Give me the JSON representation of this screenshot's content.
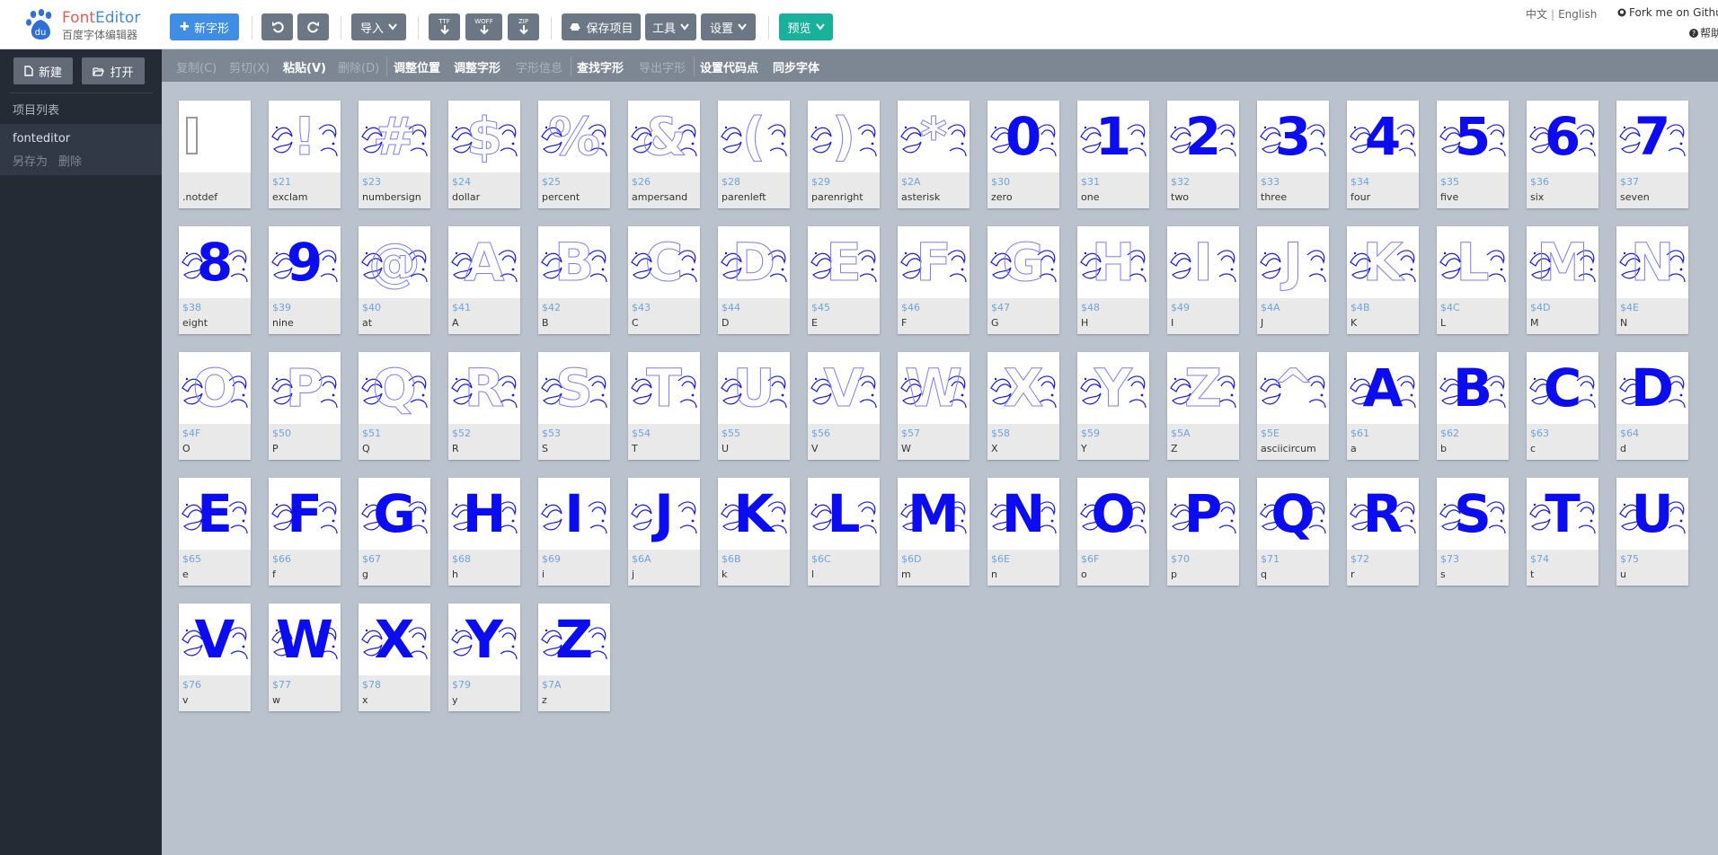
{
  "app": {
    "title_part1": "Font",
    "title_part2": "Editor",
    "subtitle": "百度字体编辑器",
    "logo_text": "du"
  },
  "toolbar": {
    "new_glyph": "新字形",
    "import": "导入",
    "export_ttf": "TTF",
    "export_woff": "WOFF",
    "export_zip": "ZIP",
    "save_project": "保存项目",
    "tools": "工具",
    "settings": "设置",
    "preview": "预览"
  },
  "lang": {
    "zh": "中文",
    "en": "English"
  },
  "links": {
    "fork": "Fork me on Github",
    "help": "帮助"
  },
  "sidebar": {
    "new_label": "新建",
    "open_label": "打开",
    "heading": "项目列表",
    "project": {
      "name": "fonteditor",
      "save_as": "另存为",
      "delete": "删除"
    }
  },
  "editbar": {
    "copy": "复制(C)",
    "cut": "剪切(X)",
    "paste": "粘贴(V)",
    "delete": "删除(D)",
    "adjust_pos": "调整位置",
    "adjust_glyph": "调整字形",
    "glyph_info": "字形信息",
    "find_glyph": "查找字形",
    "export_glyph": "导出字形",
    "set_codepoint": "设置代码点",
    "sync_font": "同步字体"
  },
  "colors": {
    "accent": "#3d8ee4",
    "teal": "#18b19c",
    "glyph_blue": "#0c0cf0",
    "sidebar_bg": "#252b35",
    "canvas_bg": "#b9c2cd"
  },
  "glyphs": [
    {
      "char": "",
      "code": "",
      "name": ".notdef",
      "style": "notdef"
    },
    {
      "char": "!",
      "code": "$21",
      "name": "exclam",
      "style": "outline"
    },
    {
      "char": "#",
      "code": "$23",
      "name": "numbersign",
      "style": "outline"
    },
    {
      "char": "$",
      "code": "$24",
      "name": "dollar",
      "style": "outline"
    },
    {
      "char": "%",
      "code": "$25",
      "name": "percent",
      "style": "outline"
    },
    {
      "char": "&",
      "code": "$26",
      "name": "ampersand",
      "style": "outline"
    },
    {
      "char": "(",
      "code": "$28",
      "name": "parenleft",
      "style": "outline"
    },
    {
      "char": ")",
      "code": "$29",
      "name": "parenright",
      "style": "outline"
    },
    {
      "char": "*",
      "code": "$2A",
      "name": "asterisk",
      "style": "outline"
    },
    {
      "char": "0",
      "code": "$30",
      "name": "zero",
      "style": "solid"
    },
    {
      "char": "1",
      "code": "$31",
      "name": "one",
      "style": "solid"
    },
    {
      "char": "2",
      "code": "$32",
      "name": "two",
      "style": "solid"
    },
    {
      "char": "3",
      "code": "$33",
      "name": "three",
      "style": "solid"
    },
    {
      "char": "4",
      "code": "$34",
      "name": "four",
      "style": "solid"
    },
    {
      "char": "5",
      "code": "$35",
      "name": "five",
      "style": "solid"
    },
    {
      "char": "6",
      "code": "$36",
      "name": "six",
      "style": "solid"
    },
    {
      "char": "7",
      "code": "$37",
      "name": "seven",
      "style": "solid"
    },
    {
      "char": "8",
      "code": "$38",
      "name": "eight",
      "style": "solid"
    },
    {
      "char": "9",
      "code": "$39",
      "name": "nine",
      "style": "solid"
    },
    {
      "char": "@",
      "code": "$40",
      "name": "at",
      "style": "outline"
    },
    {
      "char": "A",
      "code": "$41",
      "name": "A",
      "style": "outline"
    },
    {
      "char": "B",
      "code": "$42",
      "name": "B",
      "style": "outline"
    },
    {
      "char": "C",
      "code": "$43",
      "name": "C",
      "style": "outline"
    },
    {
      "char": "D",
      "code": "$44",
      "name": "D",
      "style": "outline"
    },
    {
      "char": "E",
      "code": "$45",
      "name": "E",
      "style": "outline"
    },
    {
      "char": "F",
      "code": "$46",
      "name": "F",
      "style": "outline"
    },
    {
      "char": "G",
      "code": "$47",
      "name": "G",
      "style": "outline"
    },
    {
      "char": "H",
      "code": "$48",
      "name": "H",
      "style": "outline"
    },
    {
      "char": "I",
      "code": "$49",
      "name": "I",
      "style": "outline"
    },
    {
      "char": "J",
      "code": "$4A",
      "name": "J",
      "style": "outline"
    },
    {
      "char": "K",
      "code": "$4B",
      "name": "K",
      "style": "outline"
    },
    {
      "char": "L",
      "code": "$4C",
      "name": "L",
      "style": "outline"
    },
    {
      "char": "M",
      "code": "$4D",
      "name": "M",
      "style": "outline"
    },
    {
      "char": "N",
      "code": "$4E",
      "name": "N",
      "style": "outline"
    },
    {
      "char": "O",
      "code": "$4F",
      "name": "O",
      "style": "outline"
    },
    {
      "char": "P",
      "code": "$50",
      "name": "P",
      "style": "outline"
    },
    {
      "char": "Q",
      "code": "$51",
      "name": "Q",
      "style": "outline"
    },
    {
      "char": "R",
      "code": "$52",
      "name": "R",
      "style": "outline"
    },
    {
      "char": "S",
      "code": "$53",
      "name": "S",
      "style": "outline"
    },
    {
      "char": "T",
      "code": "$54",
      "name": "T",
      "style": "outline"
    },
    {
      "char": "U",
      "code": "$55",
      "name": "U",
      "style": "outline"
    },
    {
      "char": "V",
      "code": "$56",
      "name": "V",
      "style": "outline"
    },
    {
      "char": "W",
      "code": "$57",
      "name": "W",
      "style": "outline"
    },
    {
      "char": "X",
      "code": "$58",
      "name": "X",
      "style": "outline"
    },
    {
      "char": "Y",
      "code": "$59",
      "name": "Y",
      "style": "outline"
    },
    {
      "char": "Z",
      "code": "$5A",
      "name": "Z",
      "style": "outline"
    },
    {
      "char": "^",
      "code": "$5E",
      "name": "asciicircum",
      "style": "outline"
    },
    {
      "char": "A",
      "code": "$61",
      "name": "a",
      "style": "solid"
    },
    {
      "char": "B",
      "code": "$62",
      "name": "b",
      "style": "solid"
    },
    {
      "char": "C",
      "code": "$63",
      "name": "c",
      "style": "solid"
    },
    {
      "char": "D",
      "code": "$64",
      "name": "d",
      "style": "solid"
    },
    {
      "char": "E",
      "code": "$65",
      "name": "e",
      "style": "solid"
    },
    {
      "char": "F",
      "code": "$66",
      "name": "f",
      "style": "solid"
    },
    {
      "char": "G",
      "code": "$67",
      "name": "g",
      "style": "solid"
    },
    {
      "char": "H",
      "code": "$68",
      "name": "h",
      "style": "solid"
    },
    {
      "char": "I",
      "code": "$69",
      "name": "i",
      "style": "solid"
    },
    {
      "char": "J",
      "code": "$6A",
      "name": "j",
      "style": "solid"
    },
    {
      "char": "K",
      "code": "$6B",
      "name": "k",
      "style": "solid"
    },
    {
      "char": "L",
      "code": "$6C",
      "name": "l",
      "style": "solid"
    },
    {
      "char": "M",
      "code": "$6D",
      "name": "m",
      "style": "solid"
    },
    {
      "char": "N",
      "code": "$6E",
      "name": "n",
      "style": "solid"
    },
    {
      "char": "O",
      "code": "$6F",
      "name": "o",
      "style": "solid"
    },
    {
      "char": "P",
      "code": "$70",
      "name": "p",
      "style": "solid"
    },
    {
      "char": "Q",
      "code": "$71",
      "name": "q",
      "style": "solid"
    },
    {
      "char": "R",
      "code": "$72",
      "name": "r",
      "style": "solid"
    },
    {
      "char": "S",
      "code": "$73",
      "name": "s",
      "style": "solid"
    },
    {
      "char": "T",
      "code": "$74",
      "name": "t",
      "style": "solid"
    },
    {
      "char": "U",
      "code": "$75",
      "name": "u",
      "style": "solid"
    },
    {
      "char": "V",
      "code": "$76",
      "name": "v",
      "style": "solid"
    },
    {
      "char": "W",
      "code": "$77",
      "name": "w",
      "style": "solid"
    },
    {
      "char": "X",
      "code": "$78",
      "name": "x",
      "style": "solid"
    },
    {
      "char": "Y",
      "code": "$79",
      "name": "y",
      "style": "solid"
    },
    {
      "char": "Z",
      "code": "$7A",
      "name": "z",
      "style": "solid"
    }
  ]
}
